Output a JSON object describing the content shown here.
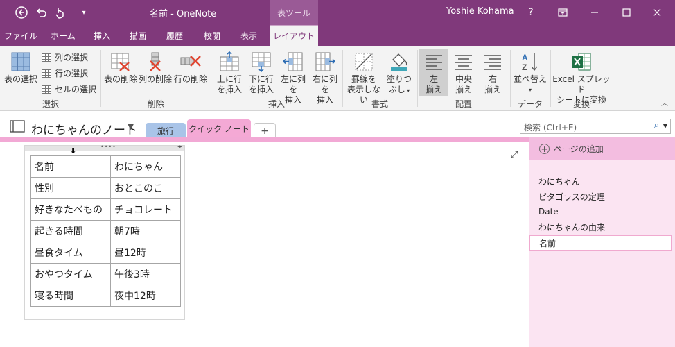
{
  "titlebar": {
    "doc_title": "名前 - OneNote",
    "context_tab_header": "表ツール",
    "user_name": "Yoshie Kohama",
    "help": "?",
    "icons": [
      "back-icon",
      "undo-icon",
      "touch-mode-icon",
      "customize-qat-icon",
      "ribbon-display-icon",
      "minimize-icon",
      "maximize-icon",
      "close-icon"
    ]
  },
  "tabs": [
    "ファイル",
    "ホーム",
    "挿入",
    "描画",
    "履歴",
    "校閲",
    "表示",
    "レイアウト"
  ],
  "active_tab": "レイアウト",
  "ribbon": {
    "select": {
      "label": "選択",
      "select_table": "表の選択",
      "select_column": "列の選択",
      "select_row": "行の選択",
      "select_cell": "セルの選択"
    },
    "delete": {
      "label": "削除",
      "delete_table": "表の削除",
      "delete_column": "列の削除",
      "delete_row": "行の削除"
    },
    "insert": {
      "label": "挿入",
      "above_l1": "上に行",
      "above_l2": "を挿入",
      "below_l1": "下に行",
      "below_l2": "を挿入",
      "left_l1": "左に列を",
      "left_l2": "挿入",
      "right_l1": "右に列を",
      "right_l2": "挿入"
    },
    "format": {
      "label": "書式",
      "hide_borders_l1": "罫線を",
      "hide_borders_l2": "表示しない",
      "shading_l1": "塗りつ",
      "shading_l2": "ぶし"
    },
    "align": {
      "label": "配置",
      "left_l1": "左",
      "left_l2": "揃え",
      "center_l1": "中央",
      "center_l2": "揃え",
      "right_l1": "右",
      "right_l2": "揃え"
    },
    "data": {
      "label": "データ",
      "sort": "並べ替え"
    },
    "convert": {
      "label": "変換",
      "excel_l1": "Excel スプレッド",
      "excel_l2": "シートに変換"
    }
  },
  "notebook": {
    "name": "わにちゃんのノート",
    "sections": [
      "旅行",
      "クイック ノート"
    ],
    "add_section": "+",
    "search_placeholder": "検索 (Ctrl+E)"
  },
  "table": {
    "rows": [
      [
        "名前",
        "わにちゃん"
      ],
      [
        "性別",
        "おとこのこ"
      ],
      [
        "好きなたべもの",
        "チョコレート"
      ],
      [
        "起きる時間",
        "朝7時"
      ],
      [
        "昼食タイム",
        "昼12時"
      ],
      [
        "おやつタイム",
        "午後3時"
      ],
      [
        "寝る時間",
        "夜中12時"
      ]
    ]
  },
  "pages": {
    "add_page": "ページの追加",
    "items": [
      "わにちゃん",
      "ピタゴラスの定理",
      "Date",
      "わにちゃんの由来",
      "名前"
    ],
    "selected": "名前"
  },
  "colors": {
    "brand": "#80397b",
    "section_travel": "#a9c4e8",
    "section_quick": "#f4a9d5",
    "pane_bg": "#fbe4f2"
  }
}
